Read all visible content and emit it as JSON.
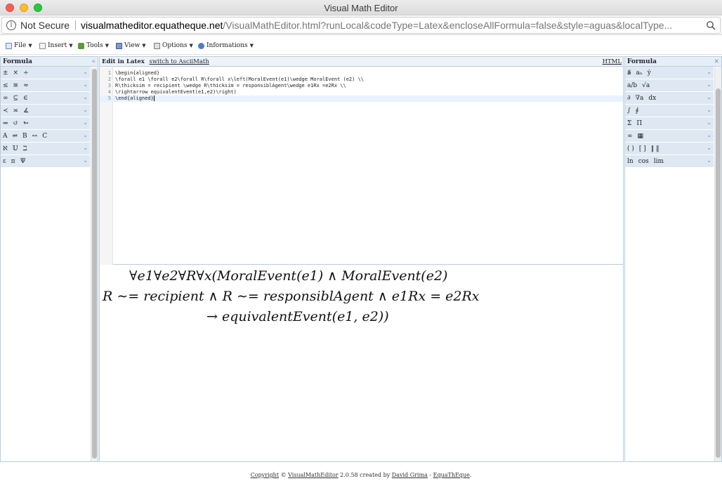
{
  "window": {
    "title": "Visual Math Editor"
  },
  "urlbar": {
    "security_label": "Not Secure",
    "host": "visualmatheditor.equatheque.net",
    "path": "/VisualMathEditor.html?runLocal&codeType=Latex&encloseAllFormula=false&style=aguas&localType..."
  },
  "toolbar": {
    "file": "File",
    "insert": "Insert",
    "tools": "Tools",
    "view": "View",
    "options": "Options",
    "informations": "Informations"
  },
  "left_panel": {
    "title": "Formula",
    "rows": [
      [
        "±",
        "×",
        "÷"
      ],
      [
        "≤",
        "≅",
        "≈"
      ],
      [
        "∞",
        "⊆",
        "∈"
      ],
      [
        "≺",
        "≍",
        "∡"
      ],
      [
        "⇒",
        "↺",
        "↬"
      ],
      [
        "A",
        "⇌",
        "B",
        "↔",
        "C"
      ],
      [
        "ℵ",
        "𝕌",
        "ℶ"
      ],
      [
        "ε",
        "π",
        "Ψ"
      ]
    ]
  },
  "right_panel": {
    "title": "Formula",
    "rows": [
      [
        "a⃗",
        "aₙ",
        "ẏ"
      ],
      [
        "a/b",
        "√a"
      ],
      [
        "∂",
        "∇a",
        "dx"
      ],
      [
        "∫",
        "∮"
      ],
      [
        "Σ",
        "Π"
      ],
      [
        "∞",
        "▦"
      ],
      [
        "( )",
        "[ ]",
        "‖ ‖"
      ],
      [
        "ln",
        "cos",
        "lim"
      ]
    ]
  },
  "editor": {
    "mode_label": "Edit in Latex",
    "switch_label": "switch to AsciiMath",
    "html_label": "HTML",
    "code_lines": [
      {
        "n": "1",
        "text": "\\begin{aligned}"
      },
      {
        "n": "2",
        "text": "\\forall e1 \\forall e2\\forall R\\forall x\\left(MoralEvent(e1)\\wedge MoralEvent (e2) \\\\"
      },
      {
        "n": "3",
        "text": "R\\thicksim = recipient \\wedge R\\thicksim = responsiblAgent\\wedge e1Rx =e2Rx \\\\"
      },
      {
        "n": "4",
        "text": "\\rightarrow equivalentEvent(e1,e2)\\right)"
      },
      {
        "n": "5",
        "text": "\\end{aligned}"
      }
    ]
  },
  "preview": {
    "line1": "∀e1∀e2∀R∀x(MoralEvent(e1) ∧ MoralEvent(e2)",
    "line2": "R ∼= recipient ∧ R ∼= responsiblAgent ∧ e1Rx = e2Rx",
    "line3": "→ equivalentEvent(e1, e2))"
  },
  "footer": {
    "copyright": "Copyright",
    "symbol": "©",
    "app": "VisualMathEditor",
    "version": "2.0.58 created by",
    "author": "David Grima",
    "dash": "-",
    "site": "EquaThEque",
    "end": "."
  }
}
